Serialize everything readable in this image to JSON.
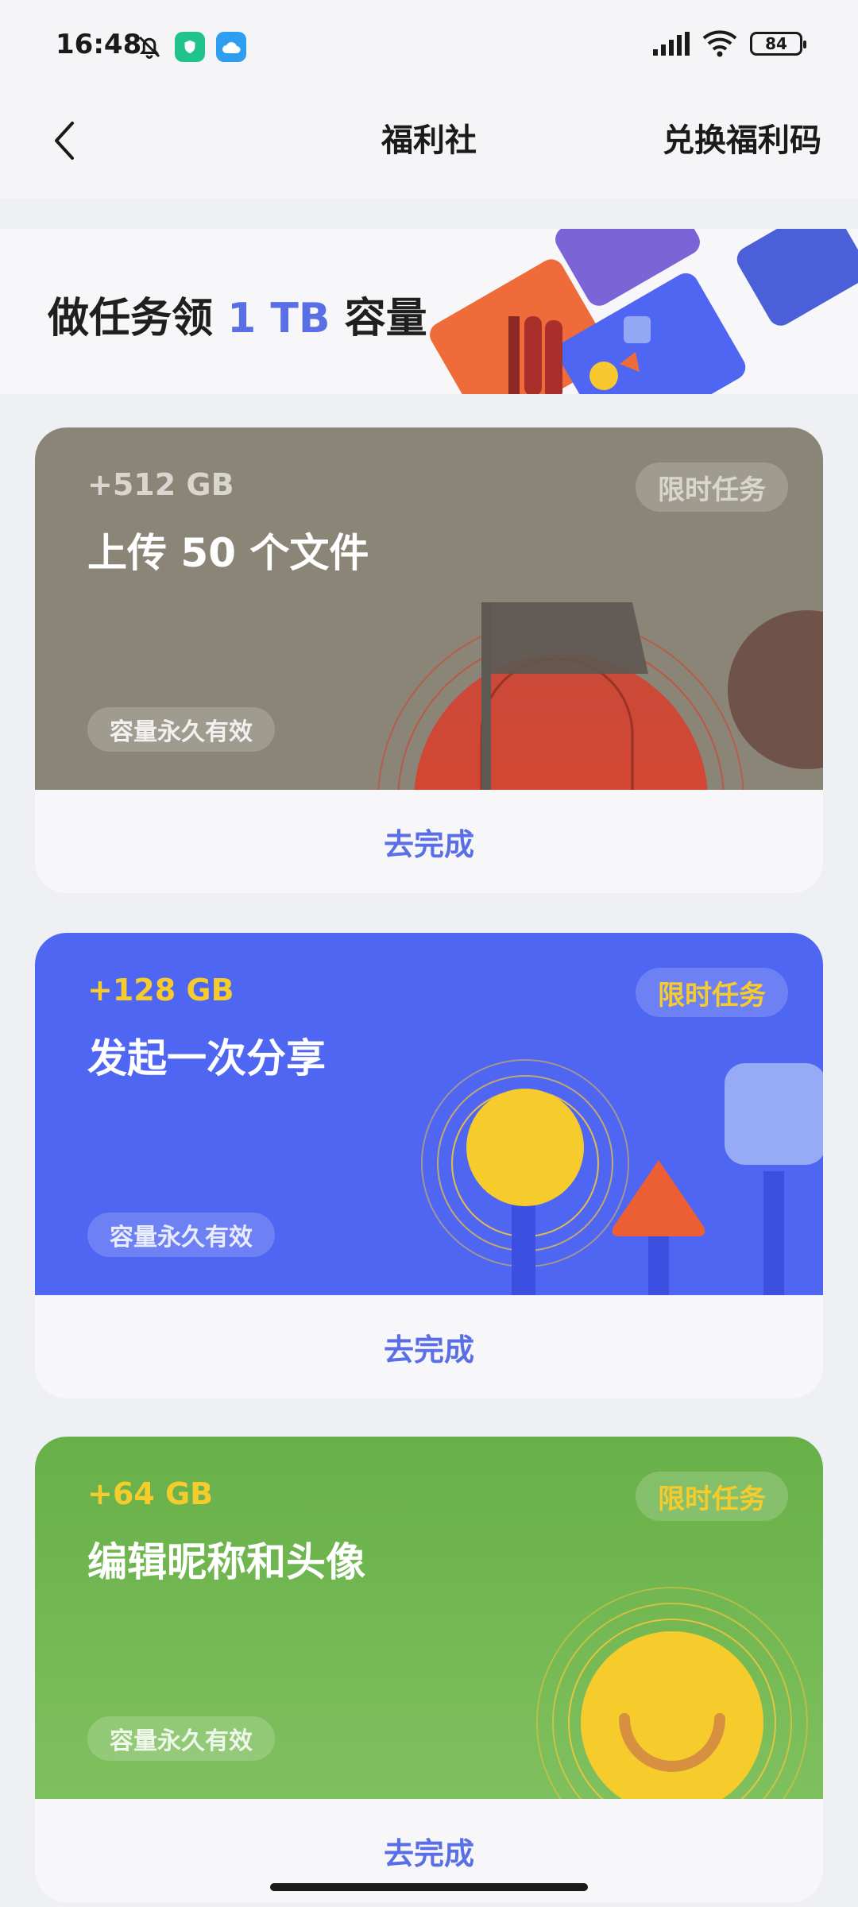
{
  "status_bar": {
    "time": "16:48",
    "battery": "84"
  },
  "nav": {
    "title": "福利社",
    "redeem_label": "兑换福利码"
  },
  "hero": {
    "prefix": "做任务领",
    "highlight": "1 TB",
    "suffix": "容量",
    "accent_color": "#5a6fe6"
  },
  "tasks": [
    {
      "reward": "+512 GB",
      "title": "上传 50 个文件",
      "tag": "限时任务",
      "validity": "容量永久有效",
      "action": "去完成",
      "bg_color": "#8a8577"
    },
    {
      "reward": "+128 GB",
      "title": "发起一次分享",
      "tag": "限时任务",
      "validity": "容量永久有效",
      "action": "去完成",
      "bg_color": "#4f66f2"
    },
    {
      "reward": "+64 GB",
      "title": "编辑昵称和头像",
      "tag": "限时任务",
      "validity": "容量永久有效",
      "action": "去完成",
      "bg_color": "#6fb64f"
    }
  ]
}
